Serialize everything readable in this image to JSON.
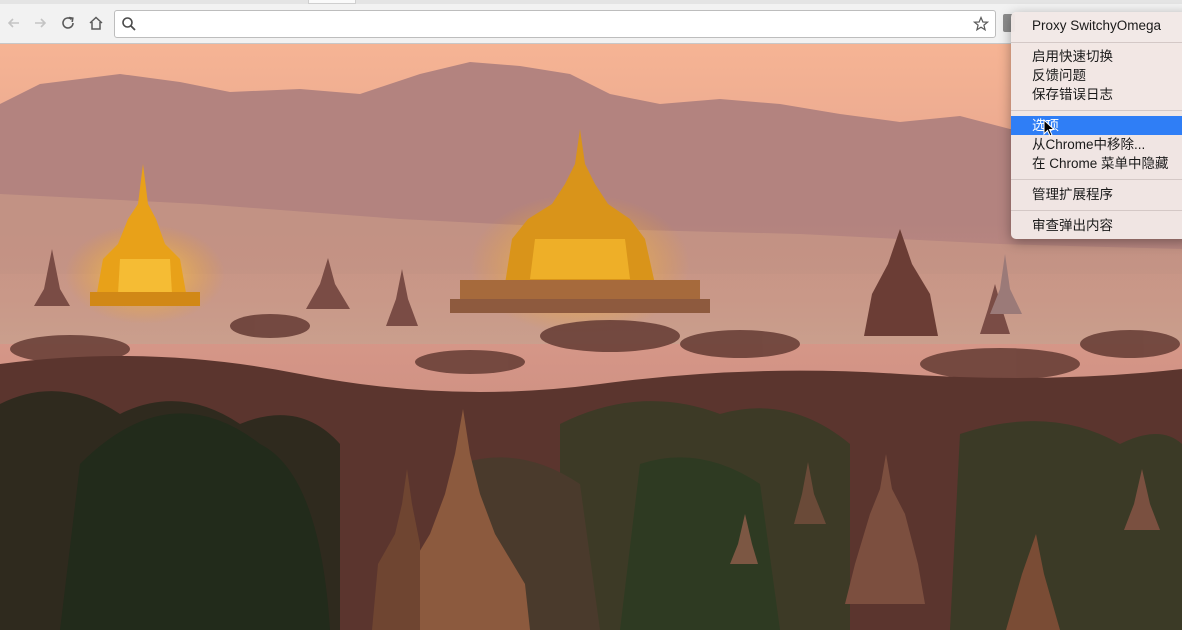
{
  "toolbar": {
    "address_value": "",
    "address_placeholder": "",
    "icons": {
      "back": "arrow-left-icon",
      "forward": "arrow-right-icon",
      "reload": "reload-icon",
      "home": "home-icon",
      "search": "search-icon",
      "bookmark": "star-icon",
      "extension": "extension-icon"
    }
  },
  "context_menu": {
    "header": "Proxy SwitchyOmega",
    "group1": [
      "启用快速切换",
      "反馈问题",
      "保存错误日志"
    ],
    "group2": [
      "选项",
      "从Chrome中移除...",
      "在 Chrome 菜单中隐藏"
    ],
    "manage": "管理扩展程序",
    "inspect": "审查弹出内容",
    "highlighted_item": "选项",
    "highlight_color": "#2f7ef6"
  },
  "background": {
    "subject": "temple-landscape-wallpaper",
    "sky_color": "#f4b596",
    "mountain_color": "#b98180",
    "temple_glow_color": "#f0a31c"
  }
}
